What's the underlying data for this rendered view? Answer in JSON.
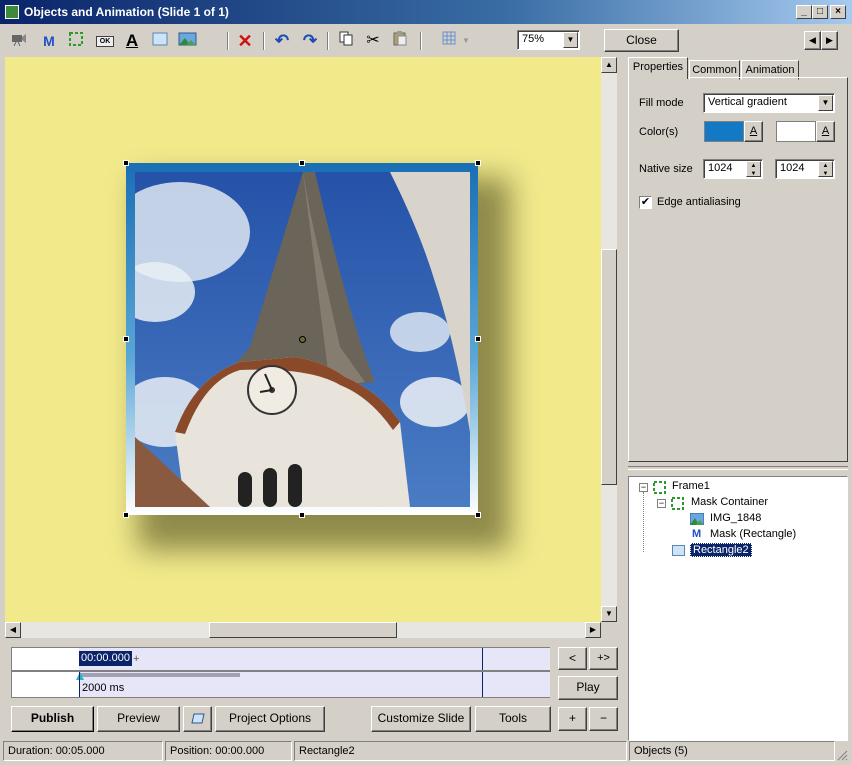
{
  "window": {
    "title": "Objects and Animation  (Slide 1 of 1)",
    "min_label": "_",
    "max_label": "□",
    "close_label": "×"
  },
  "toolbar": {
    "mask_label": "M",
    "button_label": "OK",
    "text_label": "A",
    "zoom_value": "75%",
    "close_label": "Close",
    "prev_label": "◀",
    "next_label": "▶"
  },
  "properties": {
    "tabs": [
      "Properties",
      "Common",
      "Animation"
    ],
    "fill_mode_label": "Fill mode",
    "fill_mode_value": "Vertical gradient",
    "colors_label": "Color(s)",
    "color1": "#1479c5",
    "color2": "#ffffff",
    "color_btn_label": "A",
    "native_size_label": "Native size",
    "native_w": "1024",
    "native_h": "1024",
    "edge_antialiasing_label": "Edge antialiasing",
    "edge_antialiasing_checked": true
  },
  "tree": {
    "items": [
      {
        "label": "Frame1",
        "expander": "−"
      },
      {
        "label": "Mask Container",
        "expander": "−"
      },
      {
        "label": "IMG_1848"
      },
      {
        "label": "Mask (Rectangle)"
      },
      {
        "label": "Rectangle2"
      }
    ]
  },
  "timeline": {
    "position": "00:00.000",
    "plus": "+",
    "duration": "2000 ms",
    "prev_label": "<",
    "next_label": "+>",
    "play_label": "Play",
    "add_label": "+",
    "remove_label": "−"
  },
  "bottom": {
    "publish": "Publish",
    "preview": "Preview",
    "project_options": "Project Options",
    "customize_slide": "Customize Slide",
    "tools": "Tools"
  },
  "status": {
    "duration": "Duration:  00:05.000",
    "position": "Position:  00:00.000",
    "selected": "Rectangle2",
    "objects": "Objects (5)"
  }
}
